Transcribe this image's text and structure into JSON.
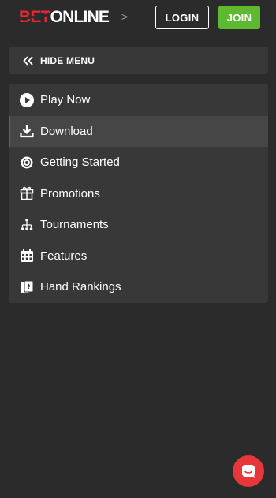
{
  "header": {
    "logo_bet": "BET",
    "logo_online": "ONLINE",
    "breadcrumb_chevron": ">",
    "login_label": "LOGIN",
    "join_label": "JOIN"
  },
  "menu_toggle": {
    "label": "HIDE MENU",
    "icon": "double-chevron-left-icon"
  },
  "menu": {
    "active_index": 1,
    "items": [
      {
        "label": "Play Now",
        "icon": "play-circle-icon"
      },
      {
        "label": "Download",
        "icon": "download-icon"
      },
      {
        "label": "Getting Started",
        "icon": "chip-icon"
      },
      {
        "label": "Promotions",
        "icon": "gift-icon"
      },
      {
        "label": "Tournaments",
        "icon": "bracket-icon"
      },
      {
        "label": "Features",
        "icon": "calendar-icon"
      },
      {
        "label": "Hand Rankings",
        "icon": "cards-icon"
      }
    ]
  },
  "chat": {
    "icon": "chat-icon"
  },
  "colors": {
    "background": "#2b2b2b",
    "panel": "#383838",
    "active_row": "#464646",
    "brand_red": "#e8262d",
    "join_green": "#5cb930"
  }
}
